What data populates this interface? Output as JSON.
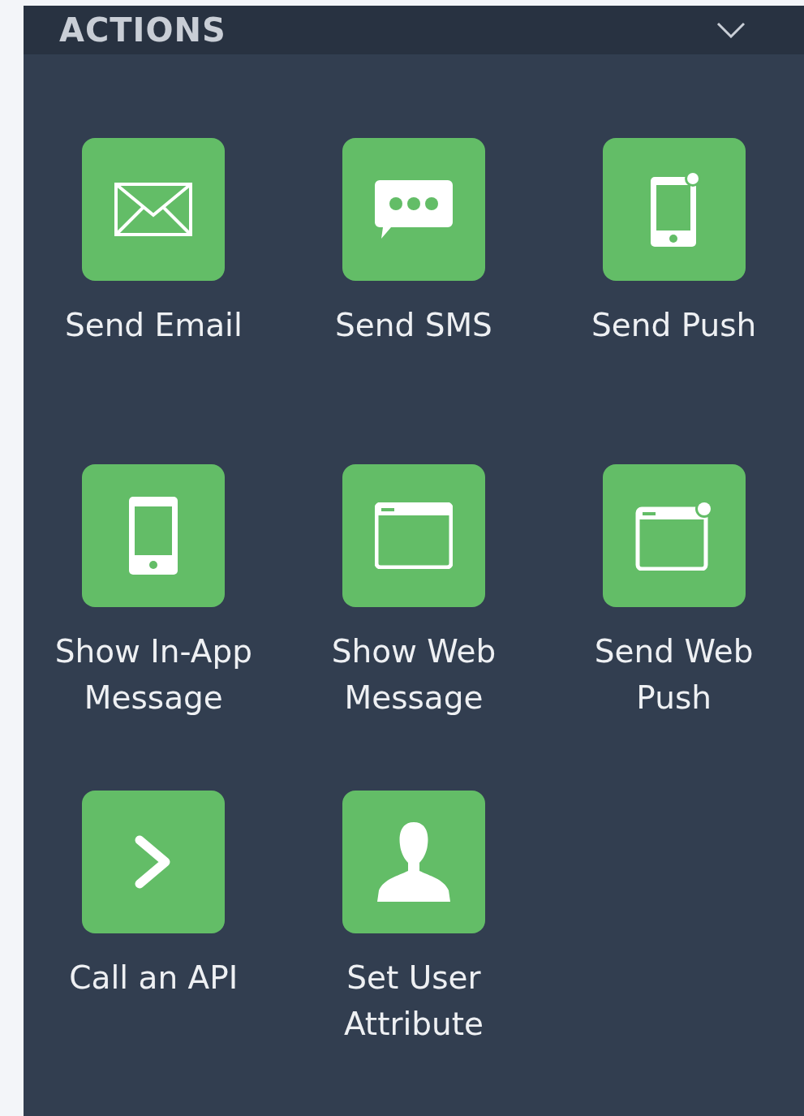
{
  "panel": {
    "title": "ACTIONS",
    "expanded": true
  },
  "actions": [
    {
      "label": "Send Email",
      "kind": "email"
    },
    {
      "label": "Send SMS",
      "kind": "sms"
    },
    {
      "label": "Send Push",
      "kind": "push"
    },
    {
      "label": "Show In-App Message",
      "kind": "inapp"
    },
    {
      "label": "Show Web Message",
      "kind": "web"
    },
    {
      "label": "Send Web Push",
      "kind": "webpush"
    },
    {
      "label": "Call an API",
      "kind": "api"
    },
    {
      "label": "Set User Attribute",
      "kind": "user"
    }
  ]
}
